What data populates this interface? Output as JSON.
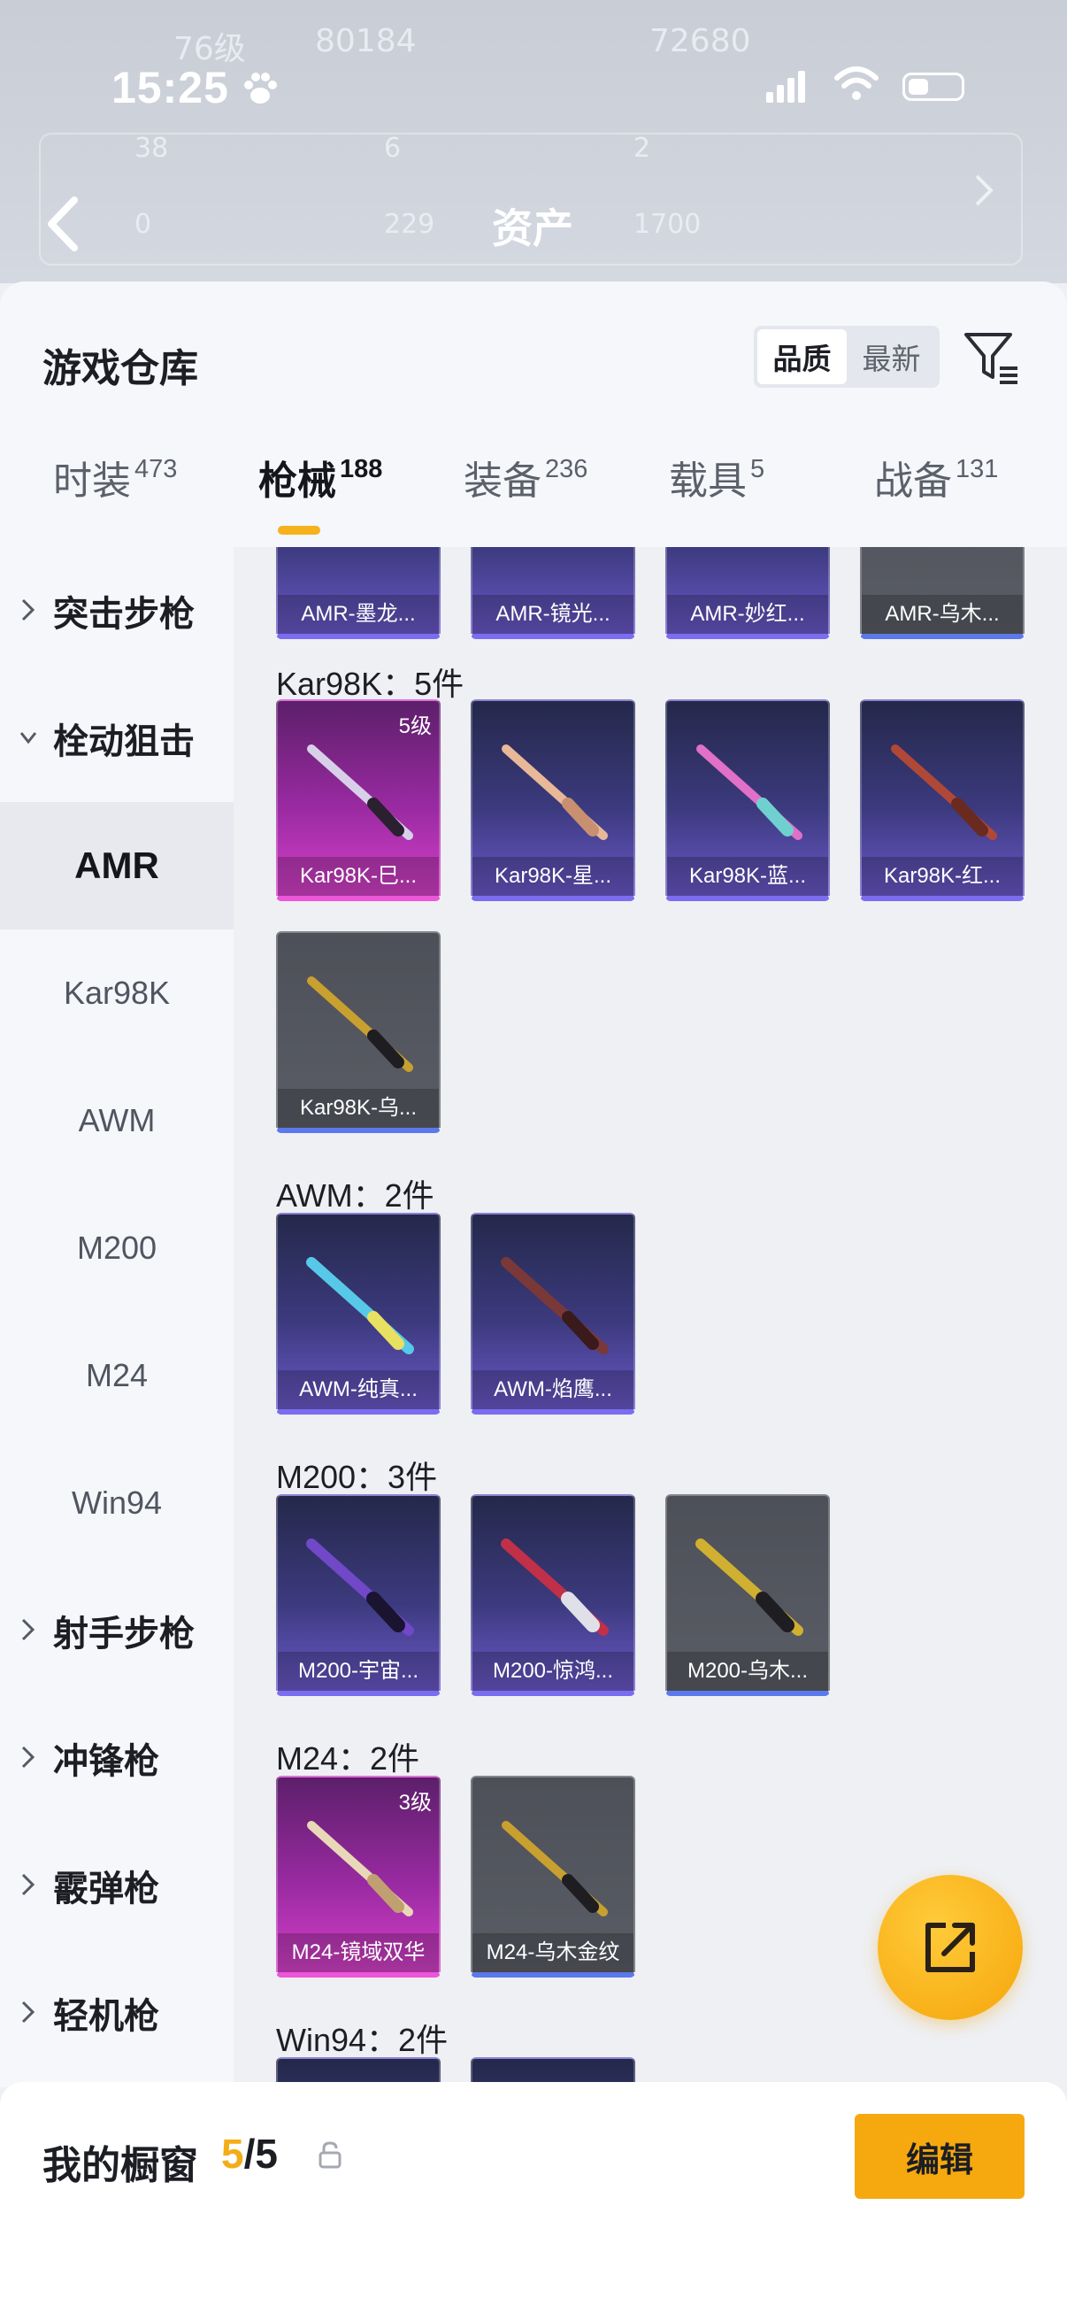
{
  "status_bar": {
    "time": "15:25"
  },
  "background": {
    "title": "资产",
    "ghost_texts": [
      "76级",
      "80184",
      "72680",
      "38",
      "6",
      "2",
      "0",
      "229",
      "1700"
    ]
  },
  "sheet": {
    "title": "游戏仓库",
    "sort": {
      "options": [
        "品质",
        "最新"
      ],
      "active": "品质"
    },
    "tabs": [
      {
        "label": "时装",
        "count": "473"
      },
      {
        "label": "枪械",
        "count": "188",
        "active": true
      },
      {
        "label": "装备",
        "count": "236"
      },
      {
        "label": "载具",
        "count": "5"
      },
      {
        "label": "战备",
        "count": "131"
      }
    ]
  },
  "categories": {
    "items": [
      {
        "label": "突击步枪",
        "type": "group",
        "expanded": false
      },
      {
        "label": "栓动狙击",
        "type": "group",
        "expanded": true
      },
      {
        "label": "AMR",
        "type": "sub",
        "active": true
      },
      {
        "label": "Kar98K",
        "type": "sub"
      },
      {
        "label": "AWM",
        "type": "sub"
      },
      {
        "label": "M200",
        "type": "sub"
      },
      {
        "label": "M24",
        "type": "sub"
      },
      {
        "label": "Win94",
        "type": "sub"
      },
      {
        "label": "射手步枪",
        "type": "group",
        "expanded": false
      },
      {
        "label": "冲锋枪",
        "type": "group",
        "expanded": false
      },
      {
        "label": "霰弹枪",
        "type": "group",
        "expanded": false
      },
      {
        "label": "轻机枪",
        "type": "group",
        "expanded": false
      }
    ]
  },
  "content": {
    "amr_partial": [
      {
        "name": "AMR-墨龙...",
        "quality": "purple"
      },
      {
        "name": "AMR-镜光...",
        "quality": "purple"
      },
      {
        "name": "AMR-妙红...",
        "quality": "purple"
      },
      {
        "name": "AMR-乌木...",
        "quality": "grey"
      }
    ],
    "sections": [
      {
        "title": "Kar98K：5件",
        "items": [
          {
            "name": "Kar98K-巳...",
            "quality": "pink",
            "level": "5级",
            "gun": "#d8d0e8"
          },
          {
            "name": "Kar98K-星...",
            "quality": "purple",
            "gun": "#e8b898"
          },
          {
            "name": "Kar98K-蓝...",
            "quality": "purple",
            "gun": "#e070c8"
          },
          {
            "name": "Kar98K-红...",
            "quality": "purple",
            "gun": "#b04838"
          },
          {
            "name": "Kar98K-乌...",
            "quality": "grey",
            "gun": "#c8a030"
          }
        ]
      },
      {
        "title": "AWM：2件",
        "items": [
          {
            "name": "AWM-纯真...",
            "quality": "purple",
            "gun": "#58c8e8"
          },
          {
            "name": "AWM-焰鹰...",
            "quality": "purple",
            "gun": "#7a3838"
          }
        ]
      },
      {
        "title": "M200：3件",
        "items": [
          {
            "name": "M200-宇宙...",
            "quality": "purple",
            "gun": "#7048c8"
          },
          {
            "name": "M200-惊鸿...",
            "quality": "purple",
            "gun": "#c03048"
          },
          {
            "name": "M200-乌木...",
            "quality": "grey",
            "gun": "#d0b030"
          }
        ]
      },
      {
        "title": "M24：2件",
        "items": [
          {
            "name": "M24-镜域双华",
            "quality": "pink",
            "level": "3级",
            "gun": "#e8d8b8"
          },
          {
            "name": "M24-乌木金纹",
            "quality": "grey",
            "gun": "#c8a030"
          }
        ]
      },
      {
        "title": "Win94：2件",
        "items": [
          {
            "name": "",
            "quality": "purple",
            "gun": "#000000"
          },
          {
            "name": "",
            "quality": "purple",
            "gun": "#000000"
          }
        ]
      }
    ]
  },
  "bottom_bar": {
    "label": "我的橱窗",
    "count_current": "5",
    "count_sep_total": "/5",
    "edit_label": "编辑"
  },
  "colors": {
    "accent": "#f6a90f",
    "purple_quality": "#6a58c8",
    "pink_quality": "#d441c8",
    "grey_quality": "#5a5d65"
  }
}
